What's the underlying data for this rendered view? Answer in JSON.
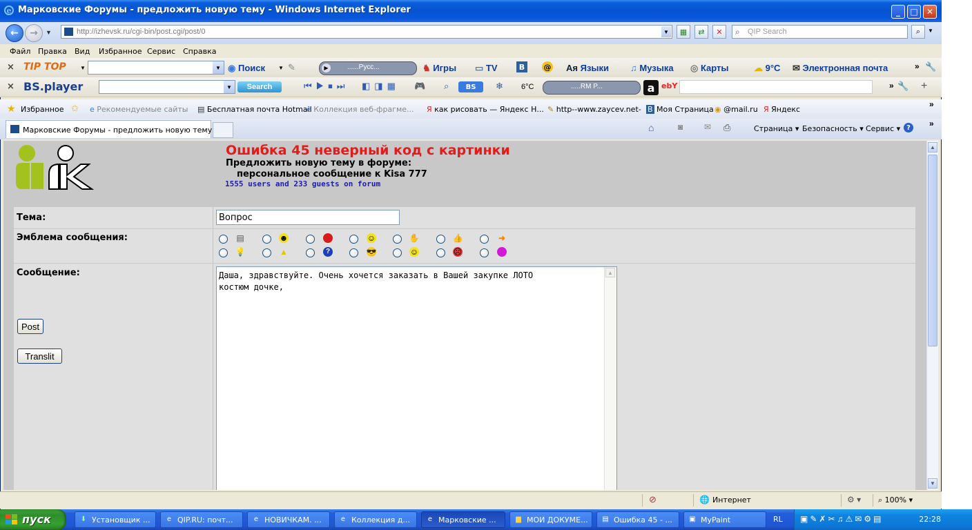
{
  "window": {
    "title": "Марковские Форумы - предложить новую тему - Windows Internet Explorer",
    "address": "http://izhevsk.ru/cgi-bin/post.cgi/post/0",
    "search_placeholder": "QIP Search"
  },
  "menu": [
    "Файл",
    "Правка",
    "Вид",
    "Избранное",
    "Сервис",
    "Справка"
  ],
  "toolbar1": {
    "items": [
      {
        "label": "Поиск"
      },
      {
        "label": "......Русс..."
      },
      {
        "label": "Игры"
      },
      {
        "label": "TV"
      },
      {
        "label": "B"
      },
      {
        "label": "Языки"
      },
      {
        "label": "Музыка"
      },
      {
        "label": "Карты"
      },
      {
        "label": "9°C"
      },
      {
        "label": "Электронная почта"
      }
    ],
    "brand": "TIP TOP"
  },
  "toolbar2": {
    "brand": "BS.player",
    "search_label": "Search",
    "temp": "6°C",
    "radio": ".....RM P..."
  },
  "favorites": {
    "label": "Избранное",
    "items": [
      {
        "label": "Рекомендуемые сайты"
      },
      {
        "label": "Бесплатная почта Hotmail"
      },
      {
        "label": "Коллекция веб-фрагме..."
      },
      {
        "label": "как рисовать — Яндекс Н..."
      },
      {
        "label": "http--www.zaycev.net-"
      },
      {
        "label": "Моя Страница"
      },
      {
        "label": "@mail.ru"
      },
      {
        "label": "Яндекс"
      }
    ]
  },
  "tab": {
    "title": "Марковские Форумы - предложить новую тему"
  },
  "commands": {
    "page": "Страница",
    "security": "Безопасность",
    "tools": "Сервис"
  },
  "page": {
    "error": "Ошибка 45 неверный код с картинки",
    "heading": "Предложить новую тему в форуме:",
    "subheading": "персональное сообщение к Kisa 777",
    "users": "1555 users and 233 guests on forum",
    "subject_label": "Тема:",
    "subject_value": "Вопрос",
    "emblem_label": "Эмблема сообщения:",
    "message_label": "Сообщение:",
    "message_text": "Даша, здравствуйте. Очень хочется заказать в Вашей закупке ЛОТО\nкостюм дочке,",
    "post_button": "Post",
    "translit_button": "Translit"
  },
  "emblems": {
    "row1": [
      "doc-icon",
      "grin-icon",
      "red-dot-icon",
      "smile-icon",
      "hand-icon",
      "thumbs-icon",
      "arrow-right-icon"
    ],
    "row2": [
      "bulb-icon",
      "warning-icon",
      "question-icon",
      "cool-icon",
      "happy-icon",
      "angry-icon",
      "purple-dot-icon"
    ]
  },
  "status": {
    "zone": "Интернет",
    "zoom": "100%"
  },
  "taskbar": {
    "start": "пуск",
    "buttons": [
      {
        "label": "Установщик ..."
      },
      {
        "label": "QIP.RU: почт..."
      },
      {
        "label": "НОВИЧКАМ. ..."
      },
      {
        "label": "Коллекция д..."
      },
      {
        "label": "Марковские ..."
      },
      {
        "label": "МОИ ДОКУМЕ..."
      },
      {
        "label": "Ошибка 45 - ..."
      },
      {
        "label": "MyPaint"
      }
    ],
    "lang": "RL",
    "clock": "22:28"
  },
  "colors": {
    "error": "#e21b1b",
    "users": "#1b1bb8",
    "titlebar": "#0653d0",
    "start": "#35a230"
  }
}
